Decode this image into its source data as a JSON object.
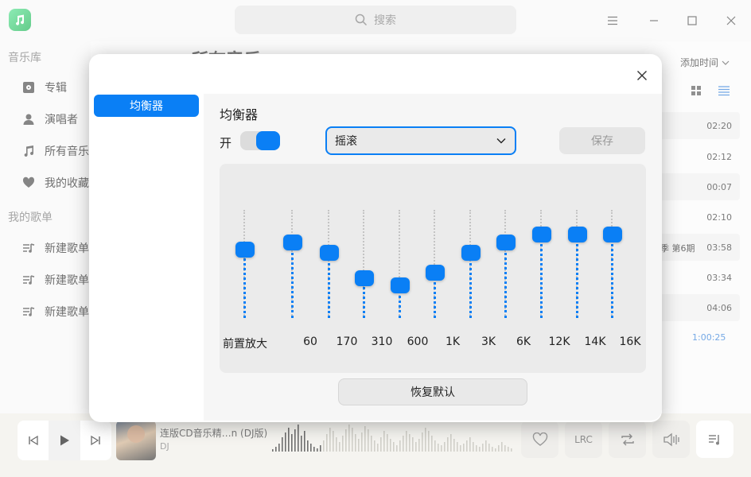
{
  "app": {
    "search_placeholder": "搜索"
  },
  "sidebar": {
    "library_heading": "音乐库",
    "library_items": [
      {
        "label": "专辑",
        "icon": "album-icon"
      },
      {
        "label": "演唱者",
        "icon": "artist-icon"
      },
      {
        "label": "所有音乐",
        "icon": "music-note-icon"
      },
      {
        "label": "我的收藏",
        "icon": "heart-icon"
      }
    ],
    "playlist_heading": "我的歌单",
    "playlists": [
      {
        "label": "新建歌单",
        "icon": "playlist-icon"
      },
      {
        "label": "新建歌单",
        "icon": "playlist-icon"
      },
      {
        "label": "新建歌单",
        "icon": "playlist-icon"
      }
    ]
  },
  "main": {
    "partial_title": "所有音乐",
    "sort_label": "添加时间",
    "track_durations": [
      "02:20",
      "02:12",
      "00:07",
      "02:10",
      "03:58",
      "03:34",
      "04:06"
    ],
    "album_partial": "季 第6期",
    "total_duration": "1:00:25"
  },
  "player": {
    "song_title": "连版CD音乐精…n (DJ版)",
    "artist": "DJ",
    "lrc_label": "LRC"
  },
  "dialog": {
    "nav_item": "均衡器",
    "title": "均衡器",
    "switch_label": "开",
    "switch_on": true,
    "preset_selected": "摇滚",
    "save_label": "保存",
    "reset_label": "恢复默认",
    "accent_color": "#0a7ff5",
    "bands": [
      {
        "label": "前置放大",
        "level": 0.63
      },
      {
        "label": "60",
        "level": 0.7
      },
      {
        "label": "170",
        "level": 0.6
      },
      {
        "label": "310",
        "level": 0.37
      },
      {
        "label": "600",
        "level": 0.3
      },
      {
        "label": "1K",
        "level": 0.42
      },
      {
        "label": "3K",
        "level": 0.6
      },
      {
        "label": "6K",
        "level": 0.7
      },
      {
        "label": "12K",
        "level": 0.77
      },
      {
        "label": "14K",
        "level": 0.77
      },
      {
        "label": "16K",
        "level": 0.77
      }
    ]
  }
}
